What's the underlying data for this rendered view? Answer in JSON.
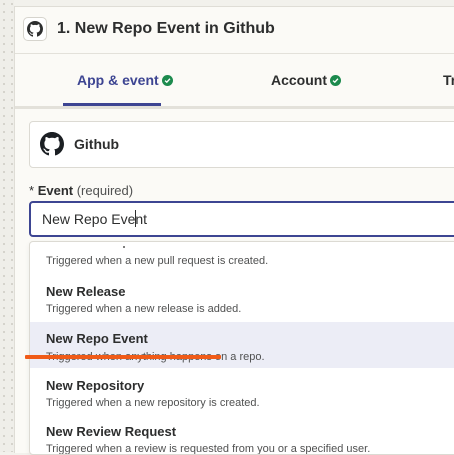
{
  "step": {
    "title": "1. New Repo Event in Github"
  },
  "tabs": [
    {
      "label": "App & event",
      "state": "complete",
      "active": true
    },
    {
      "label": "Account",
      "state": "complete",
      "active": false
    },
    {
      "label": "Tr",
      "active": false
    }
  ],
  "app": {
    "name": "Github",
    "icon": "github-icon"
  },
  "event_field": {
    "required_marker": "*",
    "label": "Event",
    "hint": "(required)",
    "value": "New Repo Event"
  },
  "options": [
    {
      "title": "",
      "description": "Triggered when a new pull request is created."
    },
    {
      "title": "New Release",
      "description": "Triggered when a new release is added."
    },
    {
      "title": "New Repo Event",
      "description": "Triggered when anything happens on a repo.",
      "selected": true
    },
    {
      "title": "New Repository",
      "description": "Triggered when a new repository is created."
    },
    {
      "title": "New Review Request",
      "description": "Triggered when a review is requested from you or a specified user."
    }
  ],
  "colors": {
    "accent": "#3d4592",
    "complete_check": "#1c8a4d",
    "annotation_underline": "#f05b18",
    "selected_row": "#ecedf6"
  }
}
